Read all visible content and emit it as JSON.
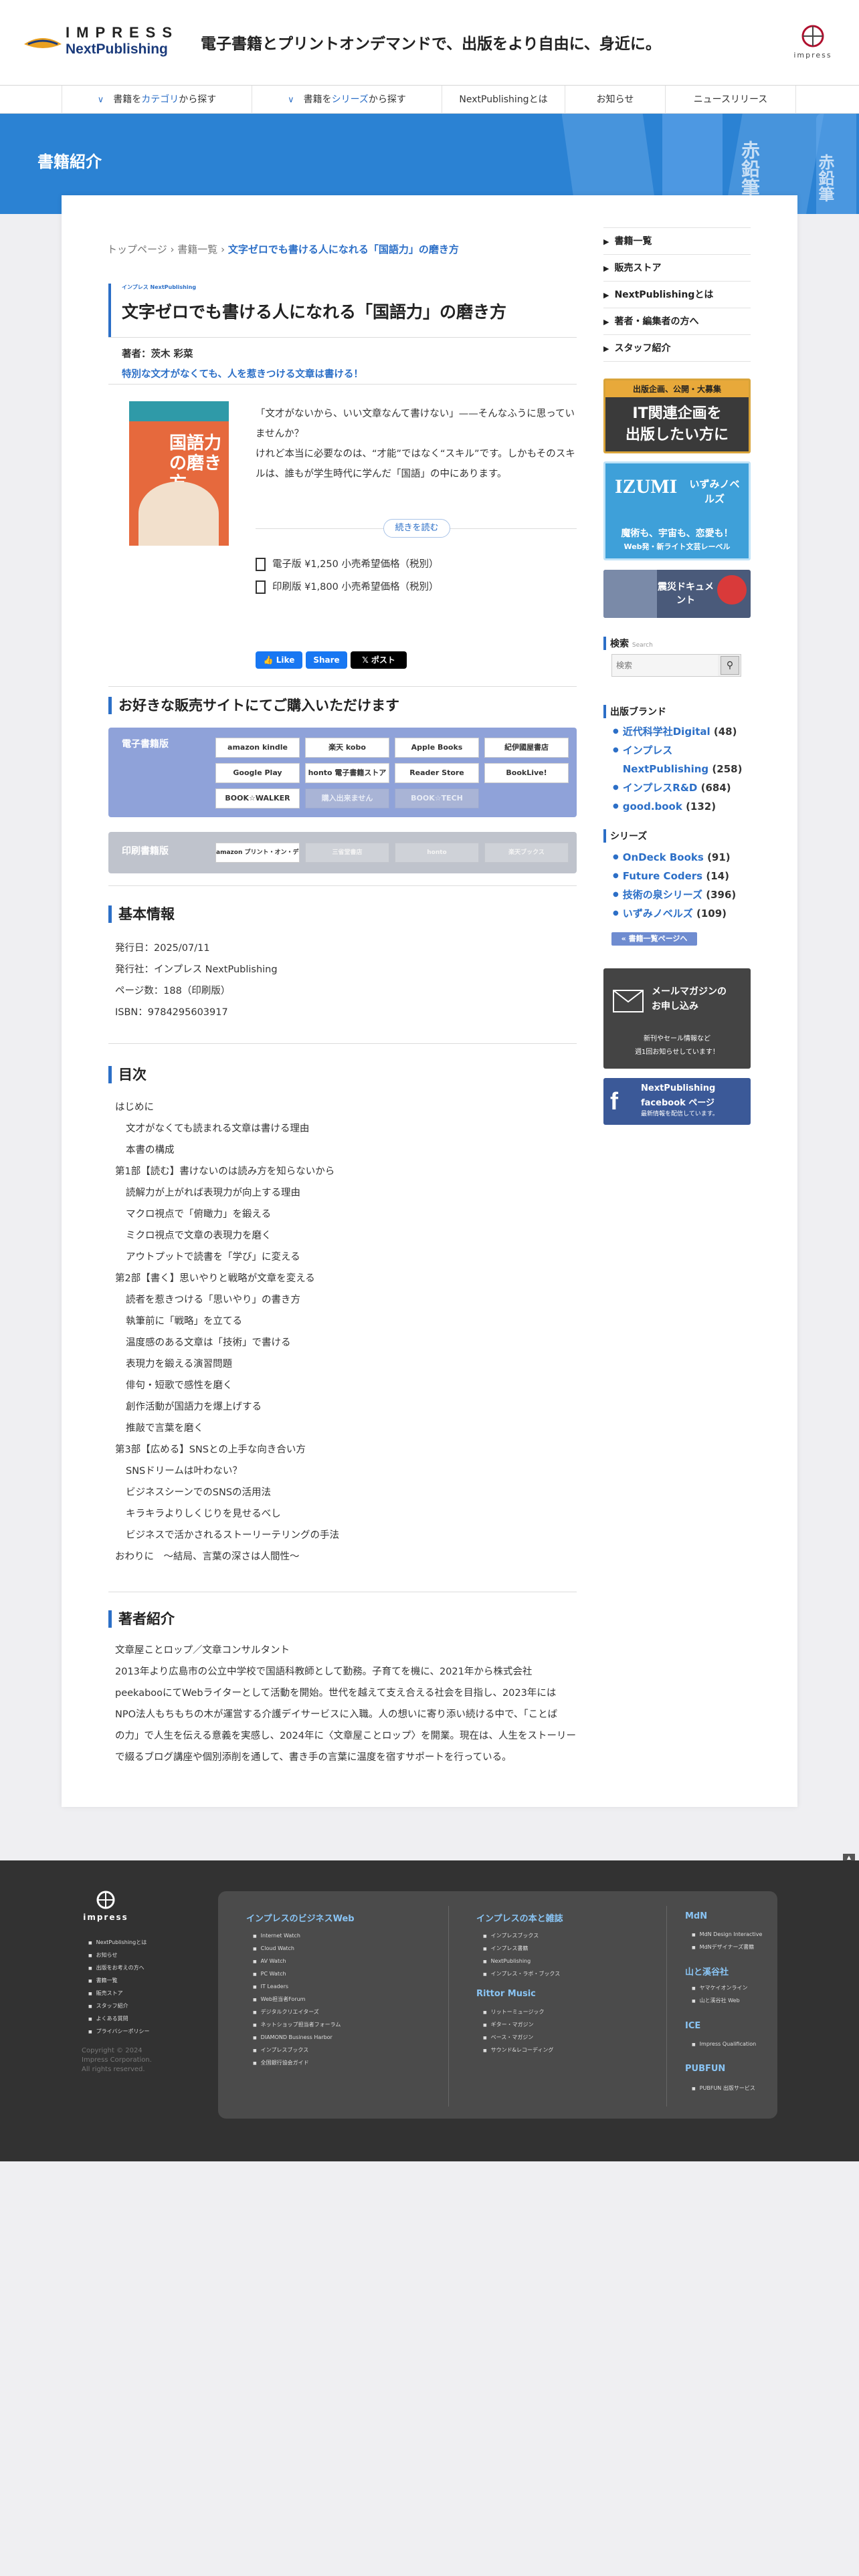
{
  "header": {
    "logo_top": "IMPRESS",
    "logo_bottom": "NextPublishing",
    "tagline": "電子書籍とプリントオンデマンドで、出版をより自由に、身近に。",
    "corner_logo": "impress"
  },
  "nav": {
    "items": [
      {
        "pre": "書籍を",
        "hl": "カテゴリ",
        "post": "から探す"
      },
      {
        "pre": "書籍を",
        "hl": "シリーズ",
        "post": "から探す"
      },
      {
        "pre": "NextPublishingとは",
        "hl": "",
        "post": ""
      },
      {
        "pre": "お知らせ",
        "hl": "",
        "post": ""
      },
      {
        "pre": "ニュースリリース",
        "hl": "",
        "post": ""
      }
    ]
  },
  "hero": {
    "title": "書籍紹介",
    "book_spine_1": "赤鉛筆",
    "book_spine_2": "赤鉛筆"
  },
  "breadcrumb": {
    "home": "トップページ",
    "list": "書籍一覧",
    "current": "文字ゼロでも書ける人になれる「国語力」の磨き方"
  },
  "book": {
    "label": "インプレス NextPublishing",
    "title": "文字ゼロでも書ける人になれる「国語力」の磨き方",
    "author": "著者：茨木 彩菜",
    "catch": "特別な文才がなくても、人を惹きつける文章は書ける！",
    "cover_text": "国語力の磨き方",
    "desc1": "「文才がないから、いい文章なんて書けない」——そんなふうに思っていませんか？",
    "desc2": "けれど本当に必要なのは、“才能”ではなく“スキル”です。しかもそのスキルは、誰もが学生時代に学んだ「国語」の中にあります。",
    "readmore": "続きを読む",
    "ebook": "電子版 ¥1,250 小売希望価格（税別）",
    "print": "印刷版 ¥1,800 小売希望価格（税別）"
  },
  "social": {
    "like": "Like",
    "share": "Share",
    "post": "ポスト"
  },
  "shops": {
    "heading": "お好きな販売サイトにてご購入いただけます",
    "ebook_label": "電子書籍版",
    "ebook_shops": [
      "amazon kindle",
      "楽天 kobo",
      "Apple Books",
      "紀伊國屋書店",
      "Google Play",
      "honto 電子書籍ストア",
      "Reader Store",
      "BookLive!",
      "BOOK☆WALKER",
      "購入出来ません",
      "BOOK☆TECH"
    ],
    "print_label": "印刷書籍版",
    "print_shops": [
      "amazon プリント・オン・デマンド",
      "三省堂書店",
      "honto",
      "楽天ブックス"
    ]
  },
  "info": {
    "heading": "基本情報",
    "date": "発行日：2025/07/11",
    "publisher": "発行社：インプレス NextPublishing",
    "pages": "ページ数：188（印刷版）",
    "isbn": "ISBN：9784295603917"
  },
  "toc": {
    "heading": "目次",
    "items": [
      {
        "t": "はじめに",
        "i": 0
      },
      {
        "t": "文才がなくても読まれる文章は書ける理由",
        "i": 1
      },
      {
        "t": "本書の構成",
        "i": 1
      },
      {
        "t": "第1部【読む】書けないのは読み方を知らないから",
        "i": 0
      },
      {
        "t": "読解力が上がれば表現力が向上する理由",
        "i": 1
      },
      {
        "t": "マクロ視点で「俯瞰力」を鍛える",
        "i": 1
      },
      {
        "t": "ミクロ視点で文章の表現力を磨く",
        "i": 1
      },
      {
        "t": "アウトプットで読書を「学び」に変える",
        "i": 1
      },
      {
        "t": "第2部【書く】思いやりと戦略が文章を変える",
        "i": 0
      },
      {
        "t": "読者を惹きつける「思いやり」の書き方",
        "i": 1
      },
      {
        "t": "執筆前に「戦略」を立てる",
        "i": 1
      },
      {
        "t": "温度感のある文章は「技術」で書ける",
        "i": 1
      },
      {
        "t": "表現力を鍛える演習問題",
        "i": 1
      },
      {
        "t": "俳句・短歌で感性を磨く",
        "i": 1
      },
      {
        "t": "創作活動が国語力を爆上げする",
        "i": 1
      },
      {
        "t": "推敲で言葉を磨く",
        "i": 1
      },
      {
        "t": "第3部【広める】SNSとの上手な向き合い方",
        "i": 0
      },
      {
        "t": "SNSドリームは叶わない？",
        "i": 1
      },
      {
        "t": "ビジネスシーンでのSNSの活用法",
        "i": 1
      },
      {
        "t": "キラキラよりしくじりを見せるべし",
        "i": 1
      },
      {
        "t": "ビジネスで活かされるストーリーテリングの手法",
        "i": 1
      },
      {
        "t": "おわりに　〜結局、言葉の深さは人間性〜",
        "i": 0
      }
    ]
  },
  "author": {
    "heading": "著者紹介",
    "lines": [
      "文章屋ことロップ／文章コンサルタント",
      "2013年より広島市の公立中学校で国語科教師として勤務。子育てを機に、2021年から株式会社",
      "peekabooにてWebライターとして活動を開始。世代を越えて支え合える社会を目指し、2023年には",
      "NPO法人もちもちの木が運営する介護デイサービスに入職。人の想いに寄り添い続ける中で、「ことば",
      "の力」で人生を伝える意義を実感し、2024年に〈文章屋ことロップ〉を開業。現在は、人生をストーリー",
      "で綴るブログ講座や個別添削を通して、書き手の言葉に温度を宿すサポートを行っている。"
    ]
  },
  "sidebar": {
    "links": [
      "書籍一覧",
      "販売ストア",
      "NextPublishingとは",
      "著者・編集者の方へ",
      "スタッフ紹介"
    ],
    "banner1": {
      "top": "出版企画、公開・大募集",
      "main1": "IT関連企画を",
      "main2": "出版したい方に"
    },
    "banner2": {
      "logo": "IZUMI",
      "name": "いずみノベルズ",
      "line1": "魔術も、宇宙も、恋愛も！",
      "line2": "Web発・新ライト文芸レーベル"
    },
    "banner3": {
      "text": "震災ドキュメント"
    },
    "search": {
      "heading": "検索",
      "sub": "Search",
      "placeholder": "検索"
    },
    "brands_heading": "出版ブランド",
    "brands": [
      {
        "name": "近代科学社Digital",
        "count": "(48)"
      },
      {
        "name": "インプレス NextPublishing",
        "count": "(258)"
      },
      {
        "name": "インプレスR&D",
        "count": "(684)"
      },
      {
        "name": "good.book",
        "count": "(132)"
      }
    ],
    "series_heading": "シリーズ",
    "series": [
      {
        "name": "OnDeck Books",
        "count": "(91)"
      },
      {
        "name": "Future Coders",
        "count": "(14)"
      },
      {
        "name": "技術の泉シリーズ",
        "count": "(396)"
      },
      {
        "name": "いずみノベルズ",
        "count": "(109)"
      }
    ],
    "all_books": "書籍一覧ページへ",
    "mail1": "メールマガジンの",
    "mail2": "お申し込み",
    "mail3": "新刊やセール情報など",
    "mail4": "週1回お知らせしています！",
    "fb1": "NextPublishing",
    "fb2": "facebook ページ",
    "fb3": "最新情報を配信しています。"
  },
  "footer": {
    "logo": "impress",
    "left_links": [
      "NextPublishingとは",
      "お知らせ",
      "出版をお考えの方へ",
      "書籍一覧",
      "販売ストア",
      "スタッフ紹介",
      "よくある質問",
      "プライバシーポリシー"
    ],
    "copyright1": "Copyright © 2024",
    "copyright2": "Impress Corporation.",
    "copyright3": "All rights reserved.",
    "col1_heading": "インプレスのビジネスWeb",
    "col1": [
      "Internet Watch",
      "Cloud Watch",
      "AV Watch",
      "PC Watch",
      "IT Leaders",
      "Web担当者Forum",
      "デジタルクリエイターズ",
      "ネットショップ担当者フォーラム",
      "DIAMOND Business Harbor",
      "インプレスブックス",
      "全国銀行協会ガイド"
    ],
    "col2_heading": "インプレスの本と雑誌",
    "col2": [
      "インプレスブックス",
      "インプレス書籍",
      "NextPublishing",
      "インプレス・ラボ・ブックス"
    ],
    "col2b_heading": "Rittor Music",
    "col2b": [
      "リットーミュージック",
      "ギター・マガジン",
      "ベース・マガジン",
      "サウンド&レコーディング"
    ],
    "col3a_heading": "MdN",
    "col3a": [
      "MdN Design Interactive",
      "MdNデザイナーズ書籍"
    ],
    "col3b_heading": "山と溪谷社",
    "col3b": [
      "ヤマケイオンライン",
      "山と溪谷社 Web"
    ],
    "col3c_heading": "ICE",
    "col3c": [
      "Impress Qualification"
    ],
    "col3d_heading": "PUBFUN",
    "col3d": [
      "PUBFUN 出版サービス"
    ]
  }
}
